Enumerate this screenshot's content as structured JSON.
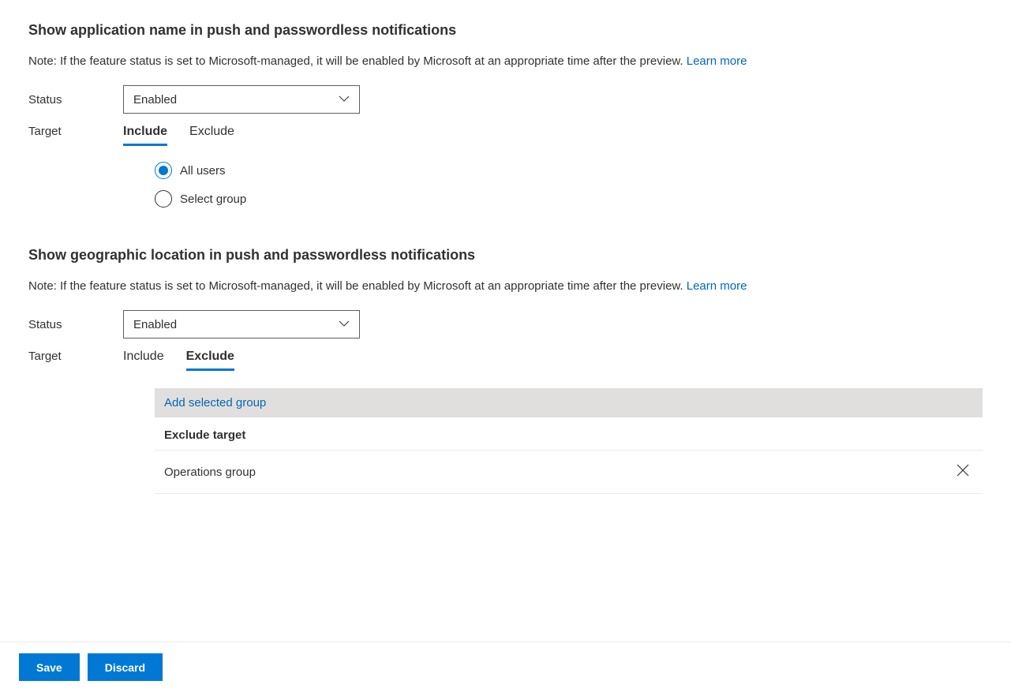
{
  "section1": {
    "title": "Show application name in push and passwordless notifications",
    "note": "Note: If the feature status is set to Microsoft-managed, it will be enabled by Microsoft at an appropriate time after the preview. ",
    "learn_more": "Learn more",
    "status_label": "Status",
    "status_value": "Enabled",
    "target_label": "Target",
    "tabs": {
      "include": "Include",
      "exclude": "Exclude"
    },
    "radios": {
      "all_users": "All users",
      "select_group": "Select group"
    }
  },
  "section2": {
    "title": "Show geographic location in push and passwordless notifications",
    "note": "Note: If the feature status is set to Microsoft-managed, it will be enabled by Microsoft at an appropriate time after the preview. ",
    "learn_more": "Learn more",
    "status_label": "Status",
    "status_value": "Enabled",
    "target_label": "Target",
    "tabs": {
      "include": "Include",
      "exclude": "Exclude"
    },
    "add_group": "Add selected group",
    "exclude_header": "Exclude target",
    "exclude_items": [
      "Operations group"
    ]
  },
  "footer": {
    "save": "Save",
    "discard": "Discard"
  }
}
